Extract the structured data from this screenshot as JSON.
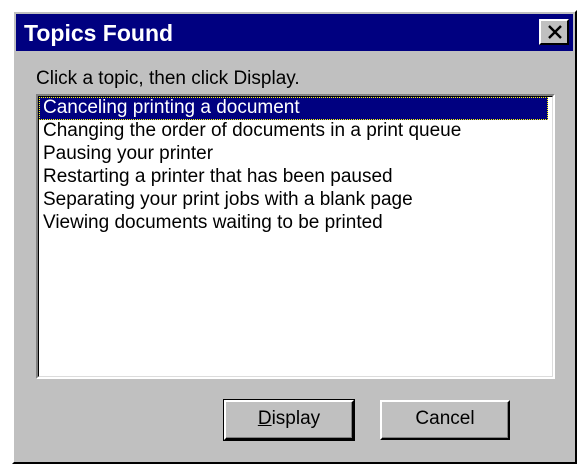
{
  "window": {
    "title": "Topics Found",
    "close_icon": "close-x-icon"
  },
  "prompt": {
    "text": "Click a topic, then click Display."
  },
  "topics": {
    "items": [
      "Canceling printing a document",
      "Changing the order of documents in a print queue",
      "Pausing your printer",
      "Restarting a printer that has been paused",
      "Separating your print jobs with a blank page",
      "Viewing documents waiting to be printed"
    ],
    "selected_index": 0
  },
  "buttons": {
    "display_mnemonic": "D",
    "display_rest": "isplay",
    "cancel_label": "Cancel"
  },
  "colors": {
    "titlebar": "#000080",
    "face": "#c0c0c0",
    "selection": "#000080"
  }
}
